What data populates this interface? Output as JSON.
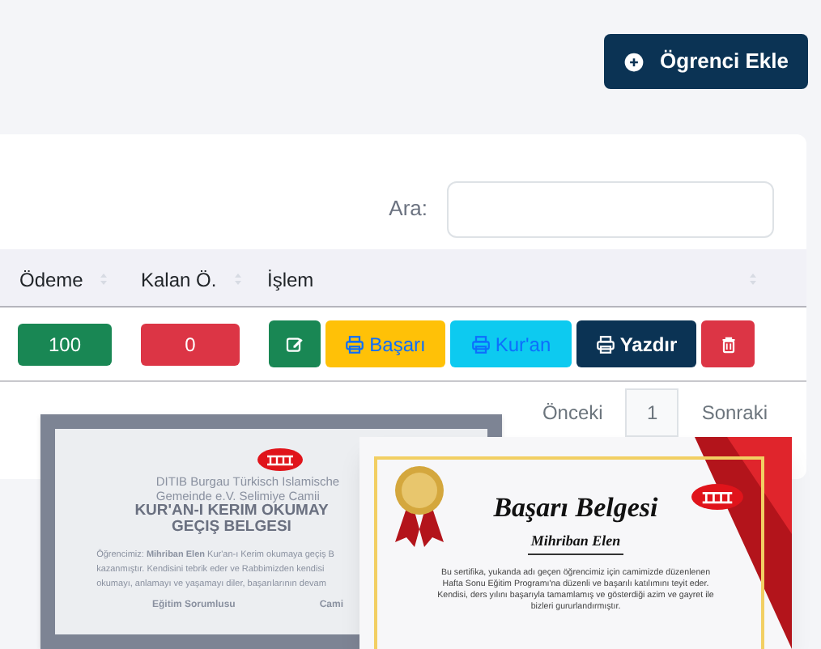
{
  "header": {
    "add_button": "Ögrenci Ekle"
  },
  "search": {
    "label": "Ara:"
  },
  "table": {
    "columns": [
      {
        "label": "Ödeme"
      },
      {
        "label": "Kalan Ö."
      },
      {
        "label": "İşlem"
      }
    ],
    "rows": [
      {
        "payment": "100",
        "remaining": "0",
        "actions": [
          {
            "kind": "edit"
          },
          {
            "kind": "certificate",
            "label": "Başarı"
          },
          {
            "kind": "quran",
            "label": "Kur'an"
          },
          {
            "kind": "print",
            "label": "Yazdır"
          },
          {
            "kind": "delete"
          }
        ]
      }
    ]
  },
  "pagination": {
    "previous": "Önceki",
    "pages": [
      {
        "label": "1",
        "selected": true
      }
    ],
    "next": "Sonraki"
  },
  "previews": [
    {
      "kind": "transfer",
      "lines": [
        "DITIB Burgau Türkisch Islamische",
        "Gemeinde e.V. Selimiye Camii"
      ],
      "title": [
        "KUR'AN-I KERIM OKUMAY",
        "GEÇIŞ BELGESI"
      ],
      "body": [
        "Öğrencimiz: **Mihriban Elen** Kur'an-ı Kerim okumaya geçiş B",
        "kazanmıştır. Kendisini tebrik eder ve Rabbimizden kendisi",
        "okumayı, anlamayı ve yaşamayı diler, başarılarının devam"
      ],
      "signatures": [
        "Eğitim Sorumlusu",
        "Cami"
      ]
    },
    {
      "kind": "success",
      "title": [
        "Başarı Belgesi"
      ],
      "name": "Mihriban Elen",
      "body": [
        "Bu sertifika, yukanda adı geçen öğrencimiz için camimizde düzenlenen",
        "Hafta Sonu Eğitim Programı'na düzenli ve başarılı katılımını teyit eder.",
        "Kendisi, ders yılını başarıyla tamamlamış ve gösterdiği azim ve gayret ile",
        "bizleri gururlandırmıştır."
      ]
    }
  ]
}
